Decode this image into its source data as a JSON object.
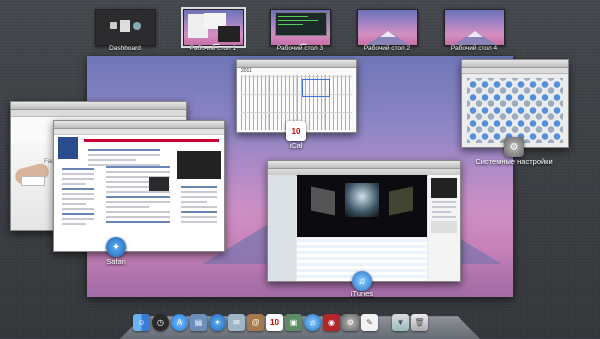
{
  "mission_control": {
    "spaces": [
      {
        "label": "Dashboard"
      },
      {
        "label": "Рабочий стол 1"
      },
      {
        "label": "Рабочий стол 3"
      },
      {
        "label": "Рабочий стол 2"
      },
      {
        "label": "Рабочий стол 4"
      }
    ],
    "windows": {
      "ical": {
        "label": "iCal",
        "year": "2011",
        "badge": "10"
      },
      "system_prefs": {
        "label": "Системные настройки"
      },
      "safari": {
        "label": "Safari"
      },
      "itunes": {
        "label": "iTunes"
      },
      "web_left": {
        "text": "Face"
      }
    }
  },
  "dock": {
    "items": [
      "finder-icon",
      "dashboard-icon",
      "app-store-icon",
      "preview-icon",
      "safari-icon",
      "mail-icon",
      "address-book-icon",
      "ical-icon",
      "iphoto-icon",
      "itunes-icon",
      "photo-booth-icon",
      "system-preferences-icon",
      "textedit-icon",
      "downloads-icon",
      "trash-icon"
    ],
    "ical_badge": "10"
  },
  "colors": {
    "wallpaper_top": "#6f77b8",
    "wallpaper_mid": "#c88ec6",
    "linen": "#3a3d42"
  }
}
